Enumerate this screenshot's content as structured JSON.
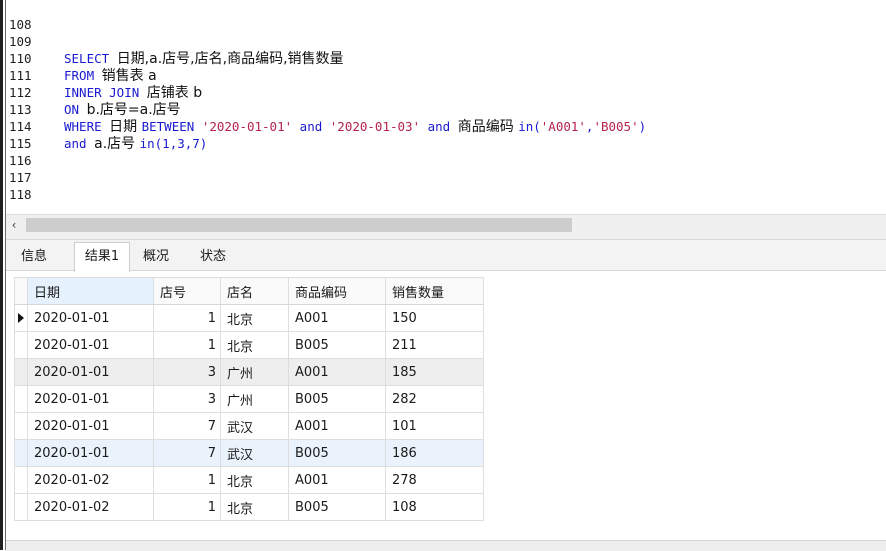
{
  "editor": {
    "lines": [
      {
        "no": "108"
      },
      {
        "no": "109",
        "kw1": "SELECT ",
        "t1": "日期,a.店号,店名,商品编码,销售数量"
      },
      {
        "no": "110",
        "kw1": "FROM ",
        "t1": "销售表 a"
      },
      {
        "no": "111",
        "kw1": "INNER JOIN ",
        "t1": "店铺表 b"
      },
      {
        "no": "112",
        "kw1": "ON ",
        "t1": "b.店号=a.店号"
      },
      {
        "no": "113",
        "kw1": "WHERE ",
        "t1": "日期 ",
        "kw2": "BETWEEN ",
        "s1": "'2020-01-01' ",
        "kw3": "and ",
        "s2": "'2020-01-03' ",
        "kw4": "and ",
        "t2": "商品编码 ",
        "kw5": "in(",
        "s3": "'A001'",
        "kw6": ",",
        "s4": "'B005'",
        "kw7": ")"
      },
      {
        "no": "114",
        "kw1": "and ",
        "t1": "a.店号 ",
        "kw2": "in(1,3,7)"
      },
      {
        "no": "115"
      },
      {
        "no": "116"
      },
      {
        "no": "117"
      },
      {
        "no": "118"
      }
    ]
  },
  "scrollbar": {
    "left_arrow": "‹"
  },
  "tabs": [
    "信息",
    "结果1",
    "概况",
    "状态"
  ],
  "grid": {
    "headers": [
      "日期",
      "店号",
      "店名",
      "商品编码",
      "销售数量"
    ],
    "rows": [
      [
        "2020-01-01",
        "1",
        "北京",
        "A001",
        "150"
      ],
      [
        "2020-01-01",
        "1",
        "北京",
        "B005",
        "211"
      ],
      [
        "2020-01-01",
        "3",
        "广州",
        "A001",
        "185"
      ],
      [
        "2020-01-01",
        "3",
        "广州",
        "B005",
        "282"
      ],
      [
        "2020-01-01",
        "7",
        "武汉",
        "A001",
        "101"
      ],
      [
        "2020-01-01",
        "7",
        "武汉",
        "B005",
        "186"
      ],
      [
        "2020-01-02",
        "1",
        "北京",
        "A001",
        "278"
      ],
      [
        "2020-01-02",
        "1",
        "北京",
        "B005",
        "108"
      ]
    ]
  }
}
